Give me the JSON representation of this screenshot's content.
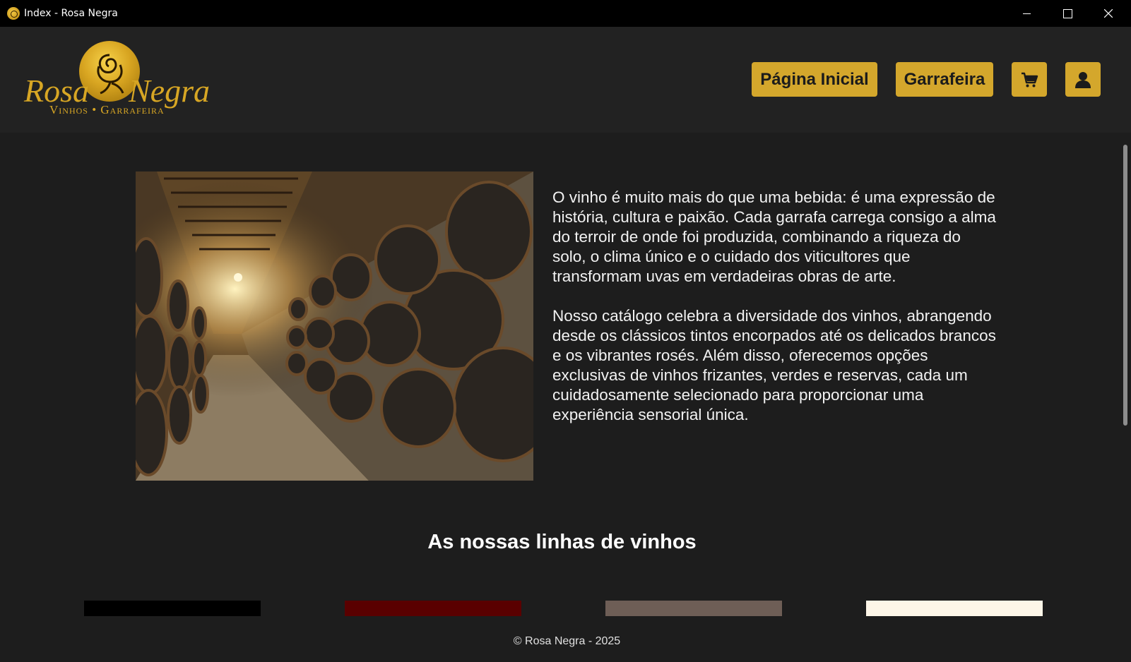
{
  "window": {
    "title": "Index - Rosa Negra"
  },
  "brand": {
    "word1": "Rosa",
    "word2": "Negra",
    "tagline": "Vinhos • Garrafeira",
    "color": "#d7a624"
  },
  "nav": {
    "home_label": "Página Inicial",
    "cellar_label": "Garrafeira",
    "cart_icon": "cart-icon",
    "user_icon": "user-icon",
    "button_color": "#d4a72c"
  },
  "intro": {
    "paragraph1": "O vinho é muito mais do que uma bebida: é uma expressão de história, cultura e paixão. Cada garrafa carrega consigo a alma do terroir de onde foi produzida, combinando a riqueza do solo, o clima único e o cuidado dos viticultores que transformam uvas em verdadeiras obras de arte.",
    "paragraph2": "Nosso catálogo celebra a diversidade dos vinhos, abrangendo desde os clássicos tintos encorpados até os delicados brancos e os vibrantes rosés. Além disso, oferecemos opções exclusivas de vinhos frizantes, verdes e reservas, cada um cuidadosamente selecionado para proporcionar uma experiência sensorial única."
  },
  "wine_lines": {
    "title": "As nossas linhas de vinhos",
    "swatch_colors": [
      "#000000",
      "#5a0000",
      "#6e5e56",
      "#fdf6e8"
    ]
  },
  "footer": {
    "text": "© Rosa Negra - 2025"
  }
}
